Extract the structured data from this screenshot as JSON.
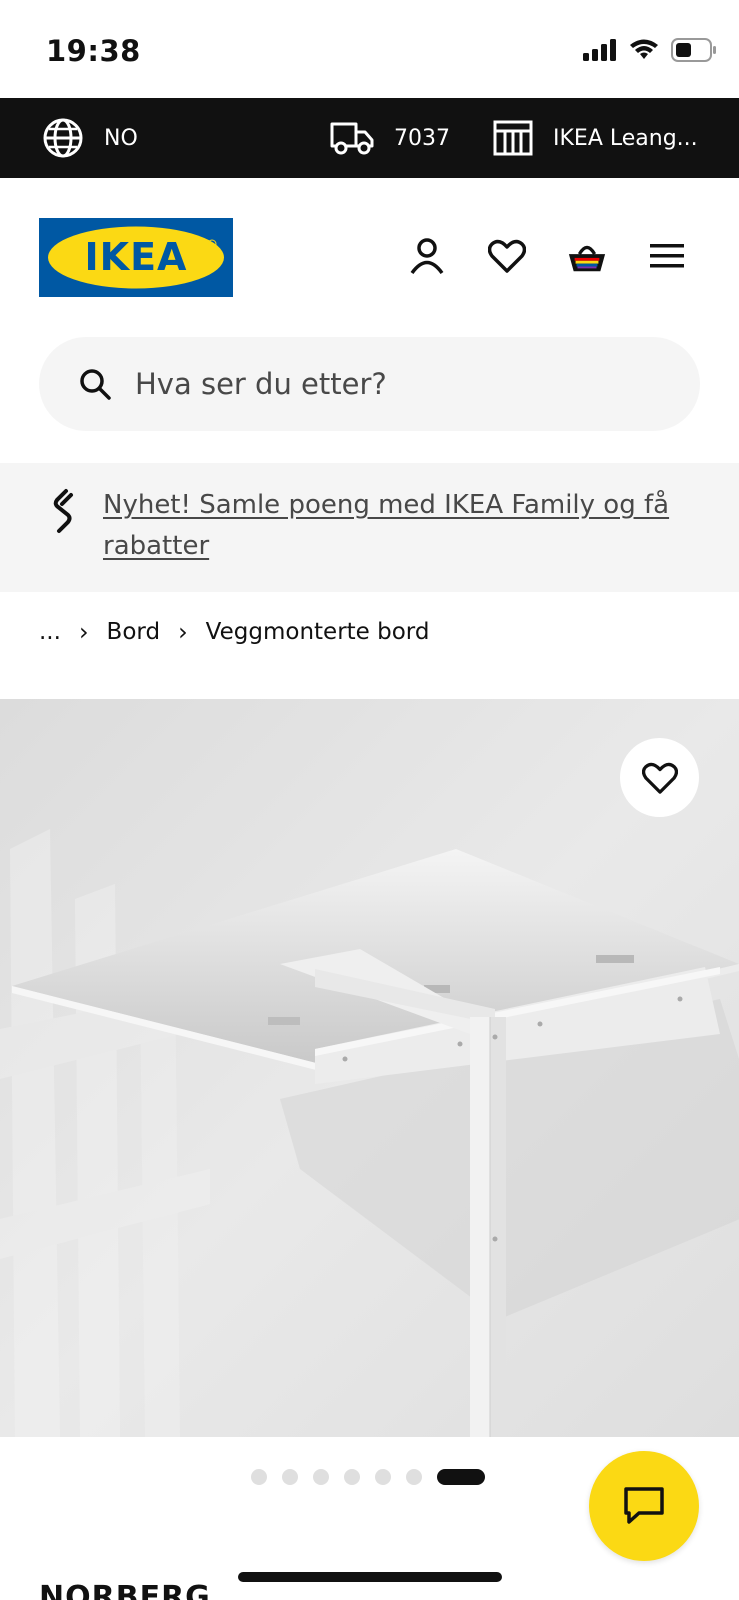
{
  "status_bar": {
    "time": "19:38",
    "icons": [
      "cellular-signal-icon",
      "wifi-icon",
      "battery-icon"
    ]
  },
  "top_strip": {
    "language": "NO",
    "postal_code": "7037",
    "store": "IKEA Leang..."
  },
  "header": {
    "logo_text": "IKEA",
    "icons": [
      "user-icon",
      "heart-icon",
      "shopping-basket-icon",
      "menu-icon"
    ]
  },
  "search": {
    "placeholder": "Hva ser du etter?"
  },
  "promo": {
    "text": "Nyhet! Samle poeng med IKEA Family og få rabatter"
  },
  "breadcrumb": {
    "items": [
      "...",
      "Bord",
      "Veggmonterte bord"
    ]
  },
  "gallery": {
    "image_count": 7,
    "active_index": 6
  },
  "product": {
    "name": "NORBERG"
  },
  "colors": {
    "brand_blue": "#0058a3",
    "brand_yellow": "#fbd914",
    "strip_bg": "#111111"
  }
}
